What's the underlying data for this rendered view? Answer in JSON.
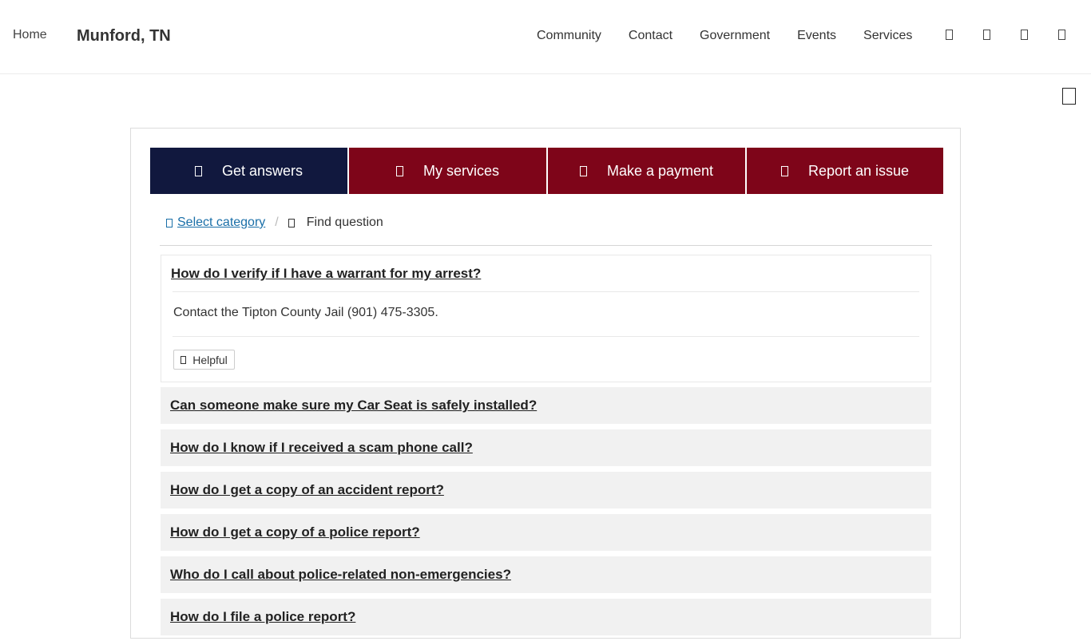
{
  "header": {
    "logo_alt": "Home",
    "site_title": "Munford, TN",
    "nav": [
      "Community",
      "Contact",
      "Government",
      "Events",
      "Services"
    ]
  },
  "icons": {
    "nav_icons": [
      "search-icon",
      "translate-icon",
      "account-icon",
      "menu-icon"
    ],
    "page_icon": "bookmark-icon"
  },
  "tabs": [
    {
      "label": "Get answers",
      "icon": "question-icon",
      "active": true
    },
    {
      "label": "My services",
      "icon": "services-icon",
      "active": false
    },
    {
      "label": "Make a payment",
      "icon": "payment-icon",
      "active": false
    },
    {
      "label": "Report an issue",
      "icon": "report-icon",
      "active": false
    }
  ],
  "breadcrumb": {
    "link": "Select category",
    "current": "Find question"
  },
  "faq": {
    "expanded": {
      "question": "How do I verify if I have a warrant for my arrest?",
      "answer": "Contact the Tipton County Jail (901) 475-3305.",
      "helpful_label": "Helpful"
    },
    "items": [
      "Can someone make sure my Car Seat is safely installed?",
      "How do I know if I received a scam phone call?",
      "How do I get a copy of an accident report?",
      "How do I get a copy of a police report?",
      "Who do I call about police-related non-emergencies?",
      "How do I file a police report?"
    ]
  },
  "colors": {
    "active_tab": "#11183e",
    "tab": "#7e0519",
    "link": "#1a6fa8",
    "faq_bg": "#f1f1f1"
  }
}
